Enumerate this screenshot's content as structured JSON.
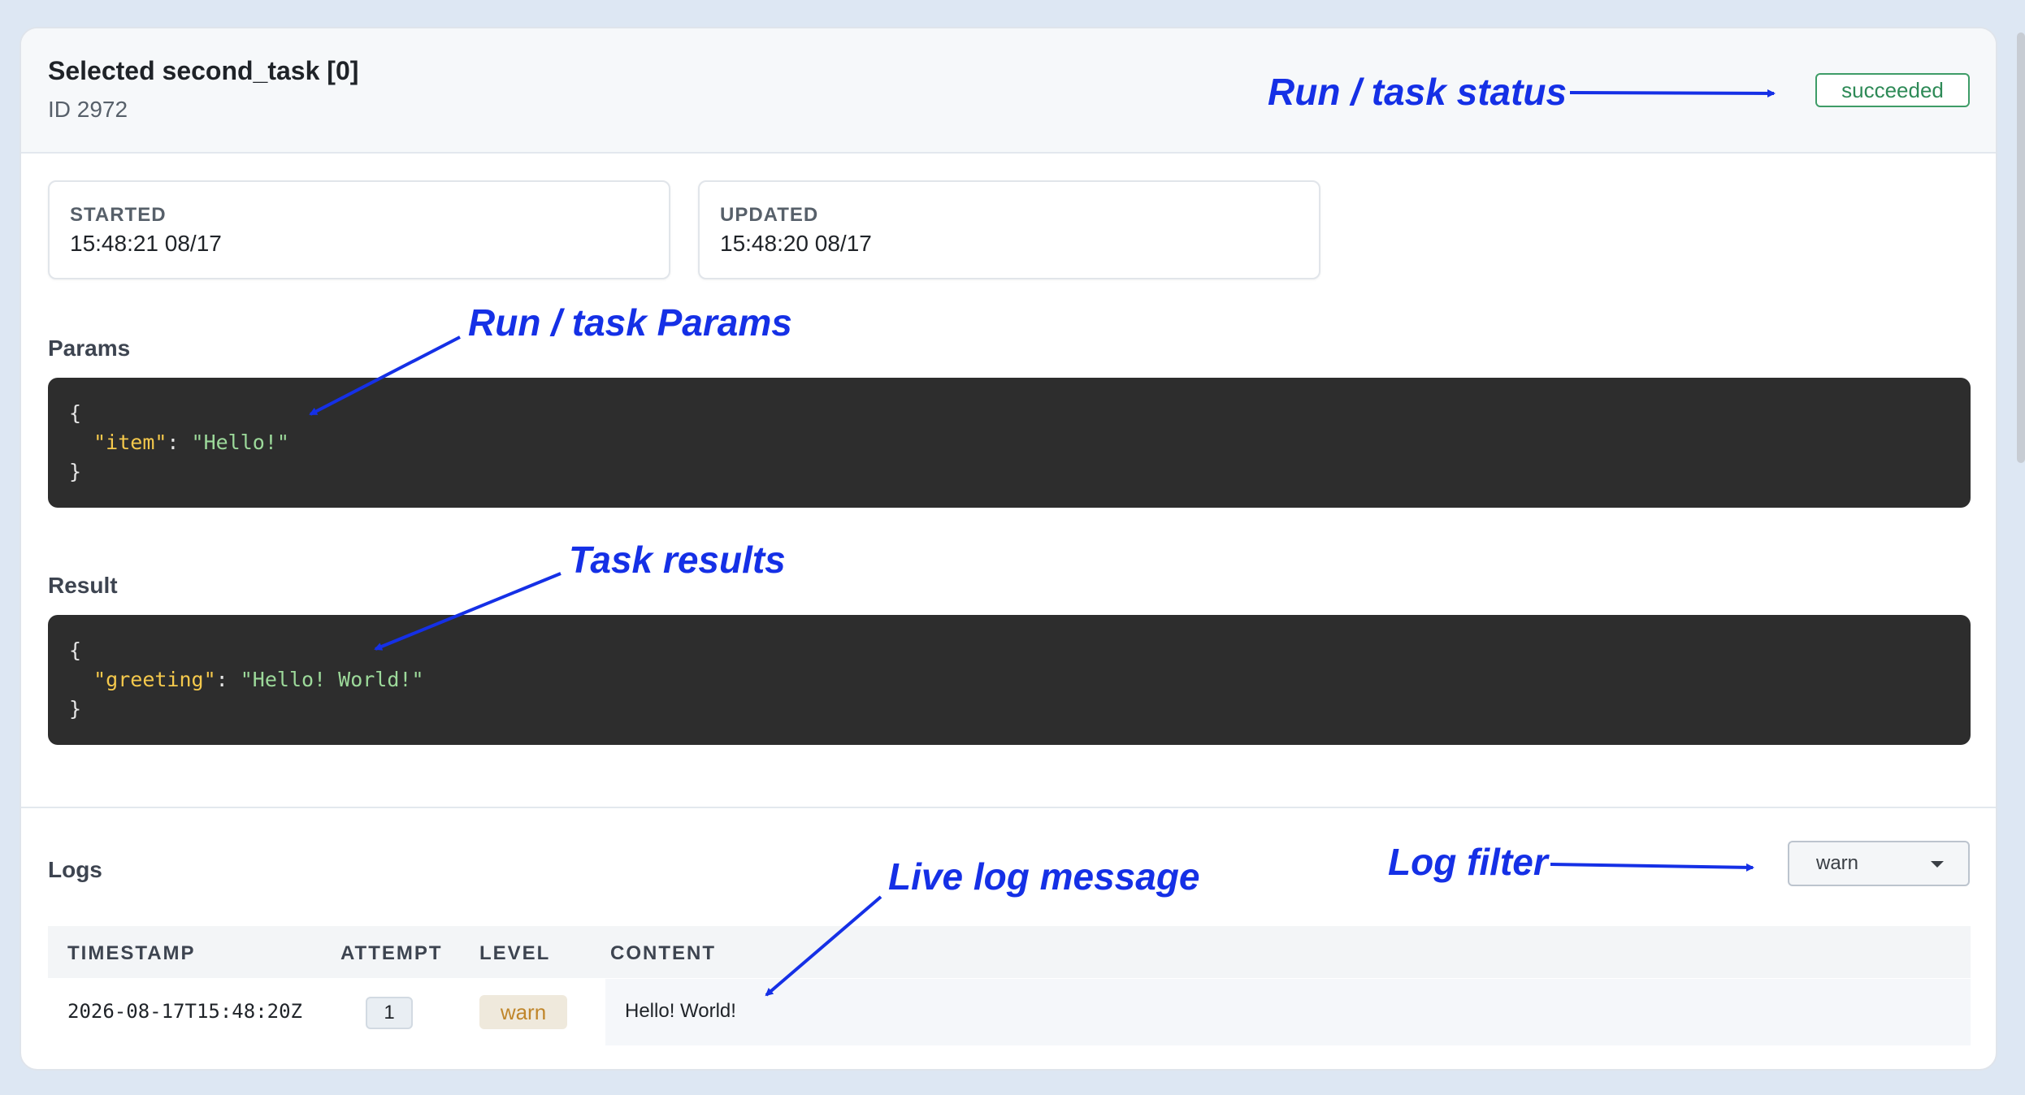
{
  "header": {
    "title": "Selected second_task [0]",
    "id_text": "ID 2972",
    "status": "succeeded"
  },
  "stats": [
    {
      "label": "STARTED",
      "value": "15:48:21 08/17"
    },
    {
      "label": "UPDATED",
      "value": "15:48:20 08/17"
    }
  ],
  "params": {
    "label": "Params",
    "key": "\"item\"",
    "value": "\"Hello!\""
  },
  "result": {
    "label": "Result",
    "key": "\"greeting\"",
    "value": "\"Hello! World!\""
  },
  "logs": {
    "label": "Logs",
    "filter_value": "warn",
    "columns": [
      "TIMESTAMP",
      "ATTEMPT",
      "LEVEL",
      "CONTENT"
    ],
    "rows": [
      {
        "timestamp": "2026-08-17T15:48:20Z",
        "attempt": "1",
        "level": "warn",
        "content": "Hello! World!"
      }
    ]
  },
  "annotations": {
    "status": "Run / task status",
    "params": "Run / task Params",
    "results": "Task results",
    "live_log": "Live log message",
    "log_filter": "Log filter"
  },
  "colors": {
    "accent_annotation": "#1530e6",
    "status_success": "#2e8a57",
    "level_warn": "#c0862b",
    "code_bg": "#2d2d2d",
    "json_key": "#f5c94c",
    "json_string": "#9cd99a"
  }
}
